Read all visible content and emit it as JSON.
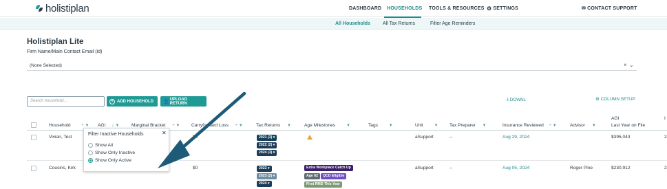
{
  "brand": {
    "name": "holistiplan",
    "accent": "#1f8a8a"
  },
  "nav": {
    "items": [
      "DASHBOARD",
      "HOUSEHOLDS",
      "TOOLS & RESOURCES",
      "SETTINGS"
    ],
    "active": "HOUSEHOLDS",
    "contact": "CONTACT SUPPORT"
  },
  "subnav": {
    "items": [
      "All Households",
      "All Tax Returns",
      "Filter Age Reminders"
    ],
    "active": "All Households"
  },
  "page": {
    "title": "Holistiplan Lite",
    "firm_label": "Firm Name/Main Contact Email (id)",
    "firm_value": "(None Selected)"
  },
  "toolbar": {
    "search_placeholder": "Search household...",
    "add_household": "ADD HOUSEHOLD",
    "upload_return": "UPLOAD RETURN",
    "download": "DOWNL",
    "column_setup": "COLUMN SETUP"
  },
  "table": {
    "headers": {
      "household": "Household",
      "agi": "AGI",
      "marginal_bracket": "Marginal Bracket",
      "carryforward_loss": "Carryforward Loss",
      "tax_returns": "Tax Returns",
      "age_milestones": "Age Milestones",
      "tags": "Tags",
      "unit": "Unit",
      "tax_preparer": "Tax Preparer",
      "insurance_reviewed": "Insurance Reviewed",
      "advisor": "Advisor",
      "agi_last_year_top": "AGI",
      "agi_last_year_bottom": "Last Year on File"
    },
    "rows": [
      {
        "household": "Vivian, Test",
        "carryforward": "$0",
        "tax_returns": [
          "2021 (3) ▾",
          "2022 (2) ▾",
          "2024 (3) ▾"
        ],
        "age_milestones": [],
        "warning": true,
        "unit": "aSupport",
        "tax_preparer": "--",
        "insurance_reviewed": "Aug 29, 2024",
        "advisor": "",
        "agi_last": "$395,043",
        "tail": "2"
      },
      {
        "household": "Cousins, Kirk",
        "carryforward": "$0",
        "tax_returns": [
          "2022 ▾",
          "2023 (2) ▾",
          "2024 ▾"
        ],
        "age_milestones": [
          "Extra Workplace Catch Up",
          "Age 62",
          "QCD Eligible",
          "First RMD This Year"
        ],
        "warning": false,
        "unit": "aSupport",
        "tax_preparer": "--",
        "insurance_reviewed": "Aug 05, 2024",
        "advisor": "Roger Pine",
        "agi_last": "$230,912",
        "tail": "2"
      }
    ]
  },
  "filter_popup": {
    "title": "Filter Inactive Households",
    "options": [
      "Show All",
      "Show Only Inactive",
      "Show Only Active"
    ],
    "selected": "Show Only Active"
  },
  "annotation": {
    "arrow_color": "#1d5b79"
  }
}
